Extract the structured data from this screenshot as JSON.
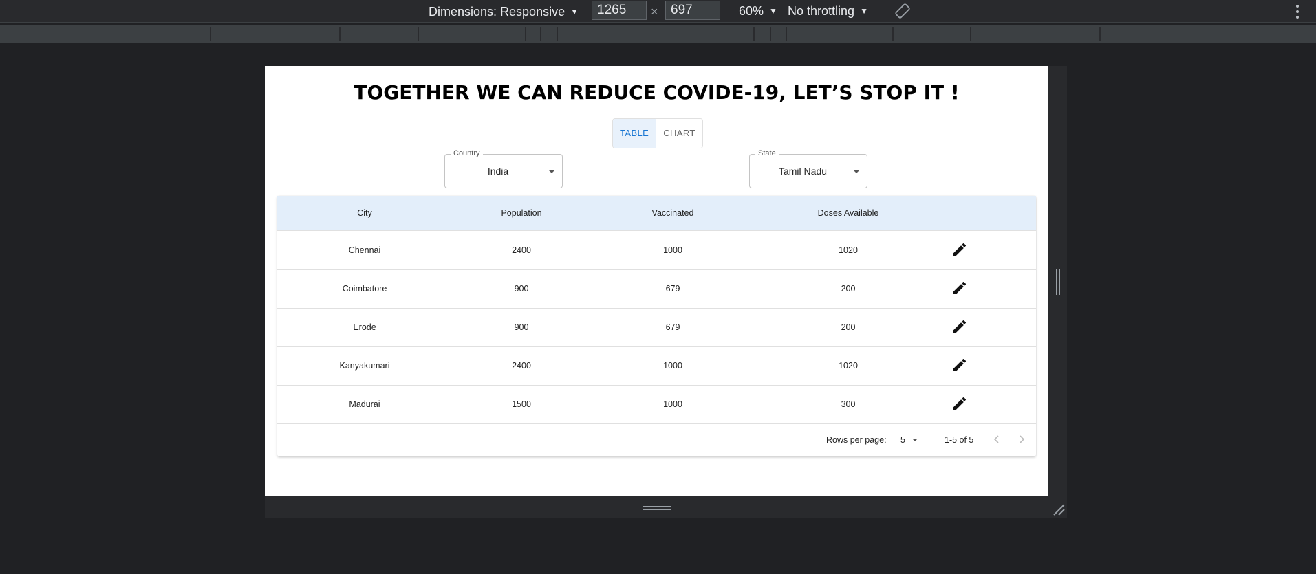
{
  "devtools": {
    "dimensions_label": "Dimensions: Responsive",
    "width_value": "1265",
    "height_value": "697",
    "times_sign": "×",
    "zoom_label": "60%",
    "throttle_label": "No throttling",
    "colors": {
      "toolbar_bg": "#292a2d",
      "workspace_bg": "#202124",
      "text": "#e8eaed"
    }
  },
  "page": {
    "title": "TOGETHER WE CAN REDUCE COVIDE-19, LET’S STOP IT !",
    "view_toggle": {
      "options": [
        "TABLE",
        "CHART"
      ],
      "selected": "TABLE"
    },
    "filters": {
      "country": {
        "label": "Country",
        "value": "India"
      },
      "state": {
        "label": "State",
        "value": "Tamil Nadu"
      }
    },
    "table": {
      "columns": [
        "City",
        "Population",
        "Vaccinated",
        "Doses Available"
      ],
      "rows": [
        {
          "city": "Chennai",
          "population": "2400",
          "vaccinated": "1000",
          "doses": "1020"
        },
        {
          "city": "Coimbatore",
          "population": "900",
          "vaccinated": "679",
          "doses": "200"
        },
        {
          "city": "Erode",
          "population": "900",
          "vaccinated": "679",
          "doses": "200"
        },
        {
          "city": "Kanyakumari",
          "population": "2400",
          "vaccinated": "1000",
          "doses": "1020"
        },
        {
          "city": "Madurai",
          "population": "1500",
          "vaccinated": "1000",
          "doses": "300"
        }
      ],
      "row_action_icon": "pencil-edit-icon"
    },
    "pagination": {
      "rows_per_page_label": "Rows per page:",
      "rows_per_page_value": "5",
      "range_label": "1-5 of 5"
    },
    "colors": {
      "accent": "#1976d2",
      "header_bg": "#e3eefa",
      "toggle_active_bg": "#e8f1fb"
    }
  }
}
